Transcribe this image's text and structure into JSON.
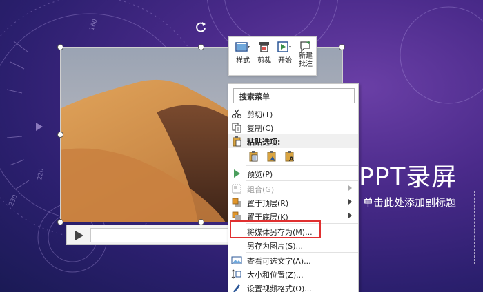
{
  "slide": {
    "title": "PPT录屏",
    "subtitle_placeholder": "单击此处添加副标题",
    "decor_numbers": [
      "160",
      "220",
      "230"
    ]
  },
  "mini_toolbar": {
    "buttons": [
      {
        "label": "样式",
        "icon": "style-icon"
      },
      {
        "label": "剪裁",
        "icon": "trim-icon"
      },
      {
        "label": "开始",
        "icon": "start-icon"
      },
      {
        "label": "新建\n批注",
        "line1": "新建",
        "line2": "批注",
        "icon": "new-comment-icon"
      }
    ]
  },
  "context_menu": {
    "search_label": "搜索菜单",
    "items": [
      {
        "label": "剪切(T)",
        "icon": "scissors-icon",
        "enabled": true
      },
      {
        "label": "复制(C)",
        "icon": "copy-icon",
        "enabled": true
      },
      {
        "label": "粘贴选项:",
        "icon": "paste-icon",
        "enabled": true
      },
      {
        "label": "预览(P)",
        "icon": "play-icon",
        "enabled": true
      },
      {
        "label": "组合(G)",
        "icon": "group-icon",
        "enabled": false,
        "submenu": true
      },
      {
        "label": "置于顶层(R)",
        "icon": "bring-to-front-icon",
        "enabled": true,
        "submenu": true
      },
      {
        "label": "置于底层(K)",
        "icon": "send-to-back-icon",
        "enabled": true,
        "submenu": true
      },
      {
        "label": "将媒体另存为(M)...",
        "icon": "",
        "enabled": true,
        "highlighted": true
      },
      {
        "label": "另存为图片(S)...",
        "icon": "",
        "enabled": true
      },
      {
        "label": "查看可选文字(A)...",
        "icon": "alt-text-icon",
        "enabled": true
      },
      {
        "label": "大小和位置(Z)...",
        "icon": "size-position-icon",
        "enabled": true
      },
      {
        "label": "设置视频格式(O)...",
        "icon": "format-video-icon",
        "enabled": true
      }
    ],
    "paste_options": [
      "paste-keep-source-icon",
      "paste-picture-icon",
      "paste-text-only-icon"
    ]
  },
  "colors": {
    "highlight": "#e03030",
    "background_dark": "#2b1f6e",
    "background_light": "#6a3fa6",
    "play_green": "#4a9e5c"
  }
}
